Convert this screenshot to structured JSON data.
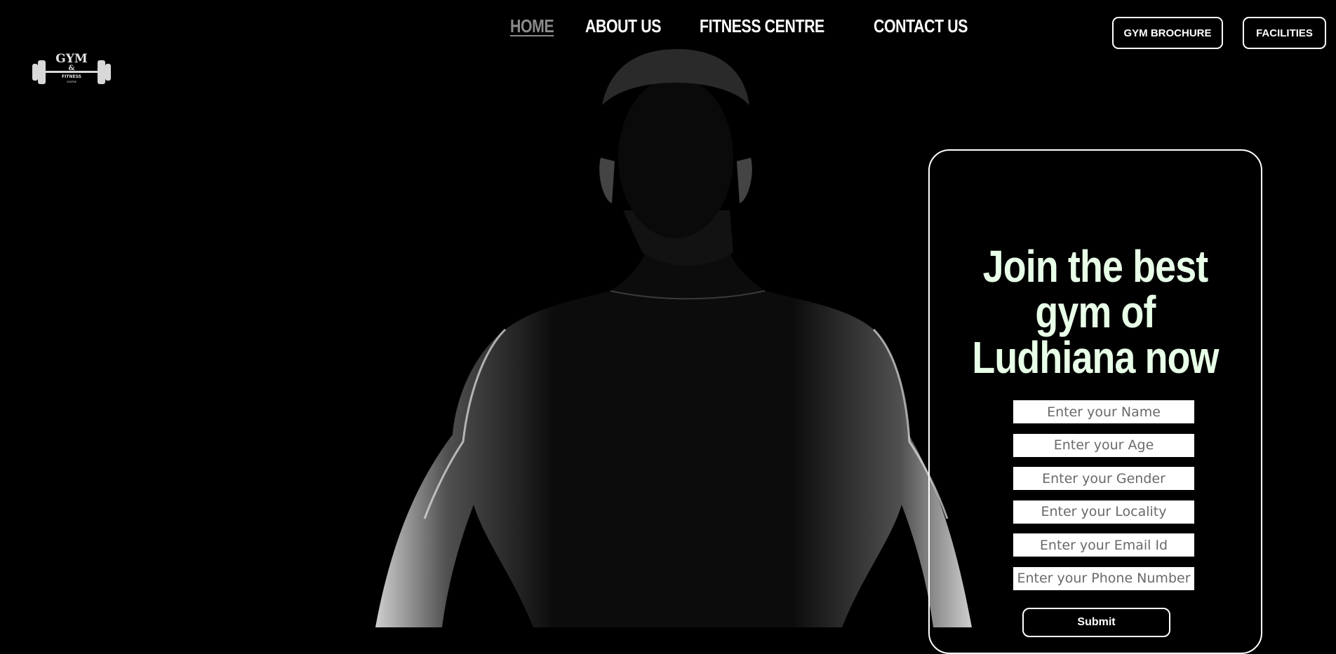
{
  "logo": {
    "line1": "GYM",
    "line2": "&",
    "line3": "FITNESS",
    "line4": "CENTRE"
  },
  "nav": {
    "items": [
      {
        "label": "HOME",
        "active": true
      },
      {
        "label": "ABOUT US"
      },
      {
        "label": "FITNESS CENTRE"
      },
      {
        "label": "CONTACT US"
      }
    ]
  },
  "header_buttons": {
    "brochure": "GYM BROCHURE",
    "facilities": "FACILITIES"
  },
  "form": {
    "title_lines": [
      "Join the best",
      "gym of",
      "Ludhiana now"
    ],
    "fields": [
      {
        "placeholder": "Enter your Name"
      },
      {
        "placeholder": "Enter your Age"
      },
      {
        "placeholder": "Enter your Gender"
      },
      {
        "placeholder": "Enter your Locality"
      },
      {
        "placeholder": "Enter your Email Id"
      },
      {
        "placeholder": "Enter your Phone Number"
      }
    ],
    "submit": "Submit"
  },
  "colors": {
    "background": "#000000",
    "title": "#e8ffe8",
    "active_nav": "#8a8a8a"
  }
}
